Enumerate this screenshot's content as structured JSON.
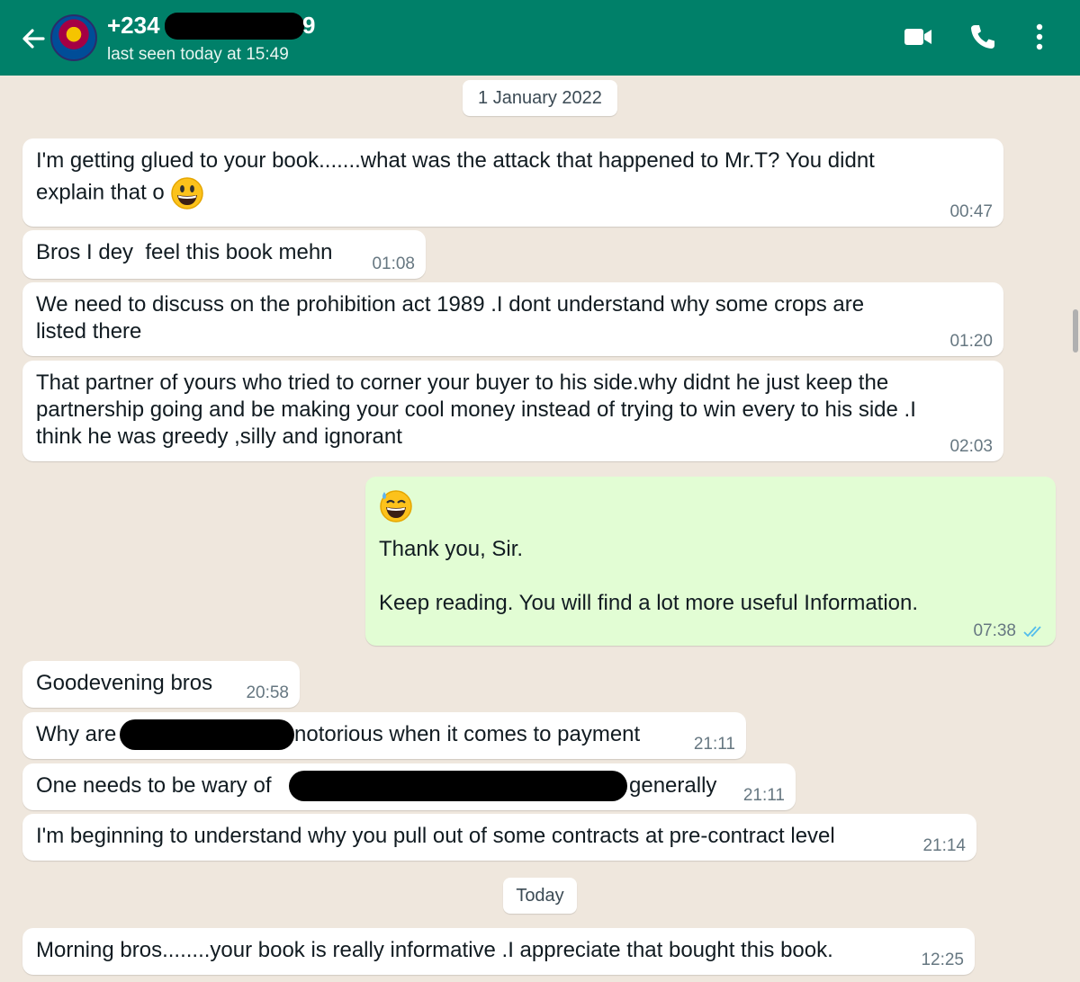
{
  "header": {
    "contact_prefix": "+234",
    "contact_suffix": "9",
    "status": "last seen today at 15:49"
  },
  "chat": {
    "date_1": "1 January 2022",
    "date_2": "Today",
    "messages": [
      {
        "text": "I'm getting glued to your book.......what was the attack that happened to Mr.T? You didnt",
        "text2": "explain that o",
        "emoji": "grinning-face",
        "time": "00:47"
      },
      {
        "text": "Bros I dey  feel this book mehn",
        "time": "01:08"
      },
      {
        "text": "We need to discuss on the prohibition act 1989 .I dont understand why some crops are\nlisted there",
        "time": "01:20"
      },
      {
        "text": "That partner of yours who tried to corner your buyer to his side.why didnt he just keep the\npartnership going and be making your cool money instead of trying to win every to his side .I\nthink he was greedy ,silly and ignorant",
        "time": "02:03"
      },
      {
        "emoji": "grinning-face-with-sweat",
        "text": "Thank you, Sir.",
        "text2": "Keep reading. You will find a lot more useful Information.",
        "time": "07:38",
        "outgoing": true,
        "status": "read"
      },
      {
        "text": "Goodevening bros",
        "time": "20:58"
      },
      {
        "text_before": "Why are",
        "text_after": "notorious when it comes to payment",
        "time": "21:11"
      },
      {
        "text_before": "One needs to be wary of",
        "text_after": "generally",
        "time": "21:11"
      },
      {
        "text": "I'm beginning to understand why you pull out of some contracts at pre-contract level",
        "time": "21:14"
      },
      {
        "text": "Morning bros........your book is really informative .I appreciate that bought this book.",
        "time": "12:25"
      }
    ]
  },
  "colors": {
    "header": "#008069",
    "chat_bg": "#efe7dd",
    "outgoing_bubble": "#e2fdd4",
    "read_ticks": "#53bdeb"
  }
}
